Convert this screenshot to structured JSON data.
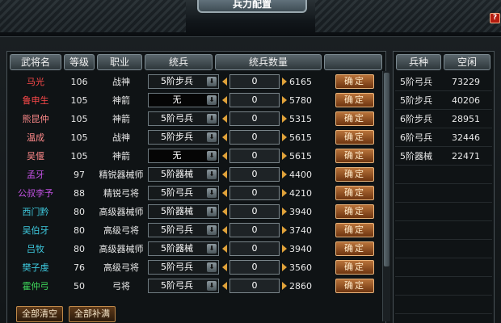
{
  "window": {
    "title": "兵力配置",
    "help": "?"
  },
  "headers": {
    "name": "武将名",
    "level": "等级",
    "job": "职业",
    "troop": "统兵",
    "troop_count": "统兵数量",
    "right_type": "兵种",
    "right_free": "空闲"
  },
  "rows": [
    {
      "name": "马光",
      "color": "#ff4a4a",
      "level": "106",
      "job": "战神",
      "troop": "5阶步兵",
      "count": "0",
      "max": "6165"
    },
    {
      "name": "鲁申生",
      "color": "#ff4a4a",
      "level": "105",
      "job": "神箭",
      "troop": "无",
      "count": "0",
      "max": "5780"
    },
    {
      "name": "熊昆仲",
      "color": "#ff8a8a",
      "level": "105",
      "job": "神箭",
      "troop": "5阶弓兵",
      "count": "0",
      "max": "5315"
    },
    {
      "name": "温成",
      "color": "#ff8a8a",
      "level": "105",
      "job": "战神",
      "troop": "5阶步兵",
      "count": "0",
      "max": "5615"
    },
    {
      "name": "吴偃",
      "color": "#ff8a8a",
      "level": "105",
      "job": "神箭",
      "troop": "无",
      "count": "0",
      "max": "5615"
    },
    {
      "name": "孟牙",
      "color": "#c050e0",
      "level": "97",
      "job": "精锐器械师",
      "troop": "5阶器械",
      "count": "0",
      "max": "4400"
    },
    {
      "name": "公叔李予",
      "color": "#c050e0",
      "level": "88",
      "job": "精锐弓将",
      "troop": "5阶弓兵",
      "count": "0",
      "max": "4210"
    },
    {
      "name": "西门黔",
      "color": "#3ecbe0",
      "level": "80",
      "job": "高级器械师",
      "troop": "5阶器械",
      "count": "0",
      "max": "3940"
    },
    {
      "name": "吴伯牙",
      "color": "#3ecbe0",
      "level": "80",
      "job": "高级弓将",
      "troop": "5阶弓兵",
      "count": "0",
      "max": "3740"
    },
    {
      "name": "吕牧",
      "color": "#3ecbe0",
      "level": "80",
      "job": "高级器械师",
      "troop": "5阶器械",
      "count": "0",
      "max": "3940"
    },
    {
      "name": "樊子虔",
      "color": "#3ecbe0",
      "level": "76",
      "job": "高级弓将",
      "troop": "5阶弓兵",
      "count": "0",
      "max": "3560"
    },
    {
      "name": "霍仲弓",
      "color": "#3ed85a",
      "level": "50",
      "job": "弓将",
      "troop": "5阶弓兵",
      "count": "0",
      "max": "2860"
    }
  ],
  "ok_label": "确定",
  "arrow_glyph": "⬇",
  "right_rows": [
    {
      "type": "5阶弓兵",
      "free": "73229"
    },
    {
      "type": "5阶步兵",
      "free": "40206"
    },
    {
      "type": "6阶步兵",
      "free": "28951"
    },
    {
      "type": "6阶弓兵",
      "free": "32446"
    },
    {
      "type": "5阶器械",
      "free": "22471"
    }
  ],
  "buttons": {
    "clear_all": "全部清空",
    "fill_all": "全部补满"
  },
  "colors": {
    "ok_button": "#b9733a",
    "header": "#5a666c"
  }
}
